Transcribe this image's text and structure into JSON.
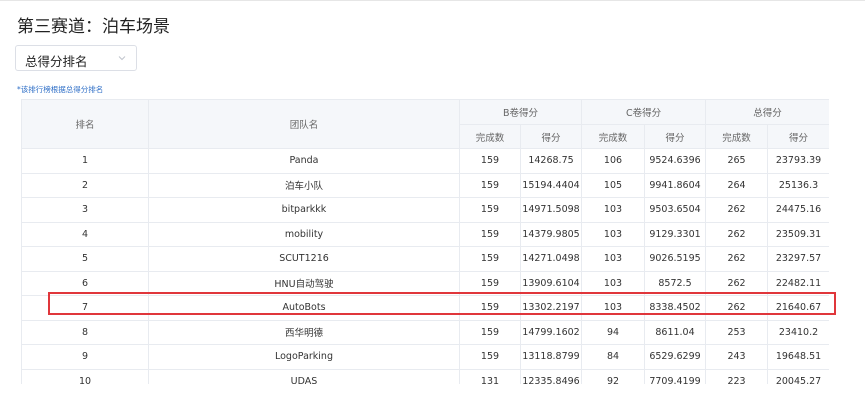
{
  "page": {
    "title": "第三赛道：泊车场景"
  },
  "select": {
    "value": "总得分排名"
  },
  "note": "*该排行榜根据总得分排名",
  "table": {
    "group_headers": {
      "rank": "排名",
      "team": "团队名",
      "b": "B卷得分",
      "c": "C卷得分",
      "total": "总得分"
    },
    "sub_headers": {
      "count": "完成数",
      "score": "得分"
    },
    "rows": [
      {
        "rank": "1",
        "team": "Panda",
        "b_count": "159",
        "b_score": "14268.75",
        "c_count": "106",
        "c_score": "9524.6396",
        "t_count": "265",
        "t_score": "23793.39"
      },
      {
        "rank": "2",
        "team": "泊车小队",
        "b_count": "159",
        "b_score": "15194.4404",
        "c_count": "105",
        "c_score": "9941.8604",
        "t_count": "264",
        "t_score": "25136.3"
      },
      {
        "rank": "3",
        "team": "bitparkkk",
        "b_count": "159",
        "b_score": "14971.5098",
        "c_count": "103",
        "c_score": "9503.6504",
        "t_count": "262",
        "t_score": "24475.16"
      },
      {
        "rank": "4",
        "team": "mobility",
        "b_count": "159",
        "b_score": "14379.9805",
        "c_count": "103",
        "c_score": "9129.3301",
        "t_count": "262",
        "t_score": "23509.31"
      },
      {
        "rank": "5",
        "team": "SCUT1216",
        "b_count": "159",
        "b_score": "14271.0498",
        "c_count": "103",
        "c_score": "9026.5195",
        "t_count": "262",
        "t_score": "23297.57"
      },
      {
        "rank": "6",
        "team": "HNU自动驾驶",
        "b_count": "159",
        "b_score": "13909.6104",
        "c_count": "103",
        "c_score": "8572.5",
        "t_count": "262",
        "t_score": "22482.11"
      },
      {
        "rank": "7",
        "team": "AutoBots",
        "b_count": "159",
        "b_score": "13302.2197",
        "c_count": "103",
        "c_score": "8338.4502",
        "t_count": "262",
        "t_score": "21640.67"
      },
      {
        "rank": "8",
        "team": "西华明德",
        "b_count": "159",
        "b_score": "14799.1602",
        "c_count": "94",
        "c_score": "8611.04",
        "t_count": "253",
        "t_score": "23410.2"
      },
      {
        "rank": "9",
        "team": "LogoParking",
        "b_count": "159",
        "b_score": "13118.8799",
        "c_count": "84",
        "c_score": "6529.6299",
        "t_count": "243",
        "t_score": "19648.51"
      },
      {
        "rank": "10",
        "team": "UDAS",
        "b_count": "131",
        "b_score": "12335.8496",
        "c_count": "92",
        "c_score": "7709.4199",
        "t_count": "223",
        "t_score": "20045.27"
      }
    ]
  },
  "colors": {
    "highlight": "#e0363b",
    "note": "#2f6fc7",
    "header_bg": "#f5f7fa"
  }
}
